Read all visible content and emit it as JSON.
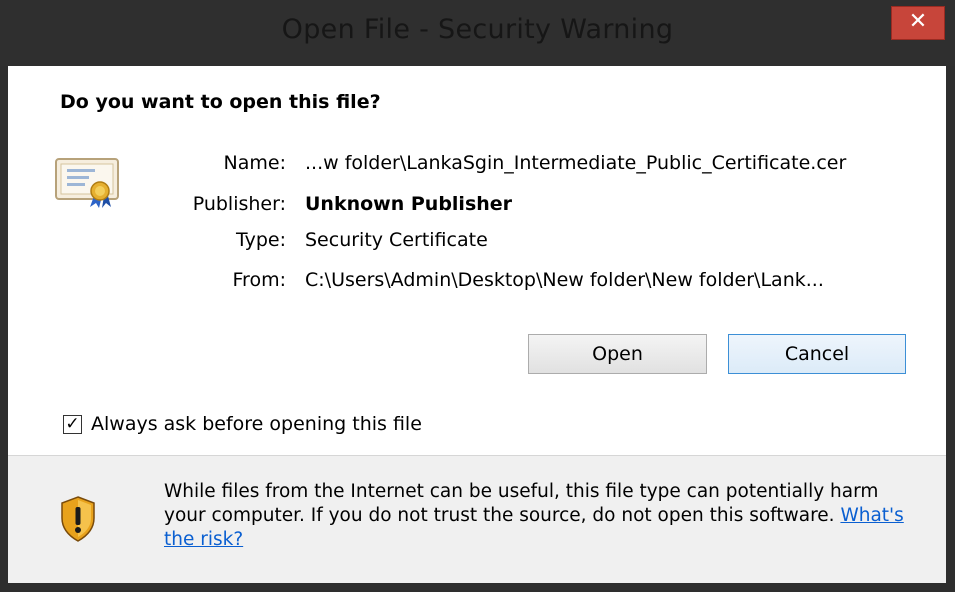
{
  "window": {
    "title": "Open File - Security Warning",
    "close_symbol": "✕"
  },
  "dialog": {
    "question": "Do you want to open this file?",
    "fields": {
      "name_label": "Name:",
      "name_value": "...w folder\\LankaSgin_Intermediate_Public_Certificate.cer",
      "publisher_label": "Publisher:",
      "publisher_value": "Unknown Publisher",
      "type_label": "Type:",
      "type_value": "Security Certificate",
      "from_label": "From:",
      "from_value": "C:\\Users\\Admin\\Desktop\\New folder\\New folder\\Lank..."
    },
    "buttons": {
      "open_label": "Open",
      "cancel_label": "Cancel"
    },
    "checkbox": {
      "label": "Always ask before opening this file",
      "checked": true,
      "mark": "✓"
    }
  },
  "footer": {
    "warning_text": "While files from the Internet can be useful, this file type can potentially harm your computer. If you do not trust the source, do not open this software.",
    "risk_link": "What's the risk?"
  },
  "icons": {
    "file_icon": "certificate-icon",
    "warning_icon": "shield-warning-icon"
  },
  "colors": {
    "close_button": "#c7453a",
    "link": "#0a5fd1",
    "footer_bg": "#f0f0f0"
  }
}
